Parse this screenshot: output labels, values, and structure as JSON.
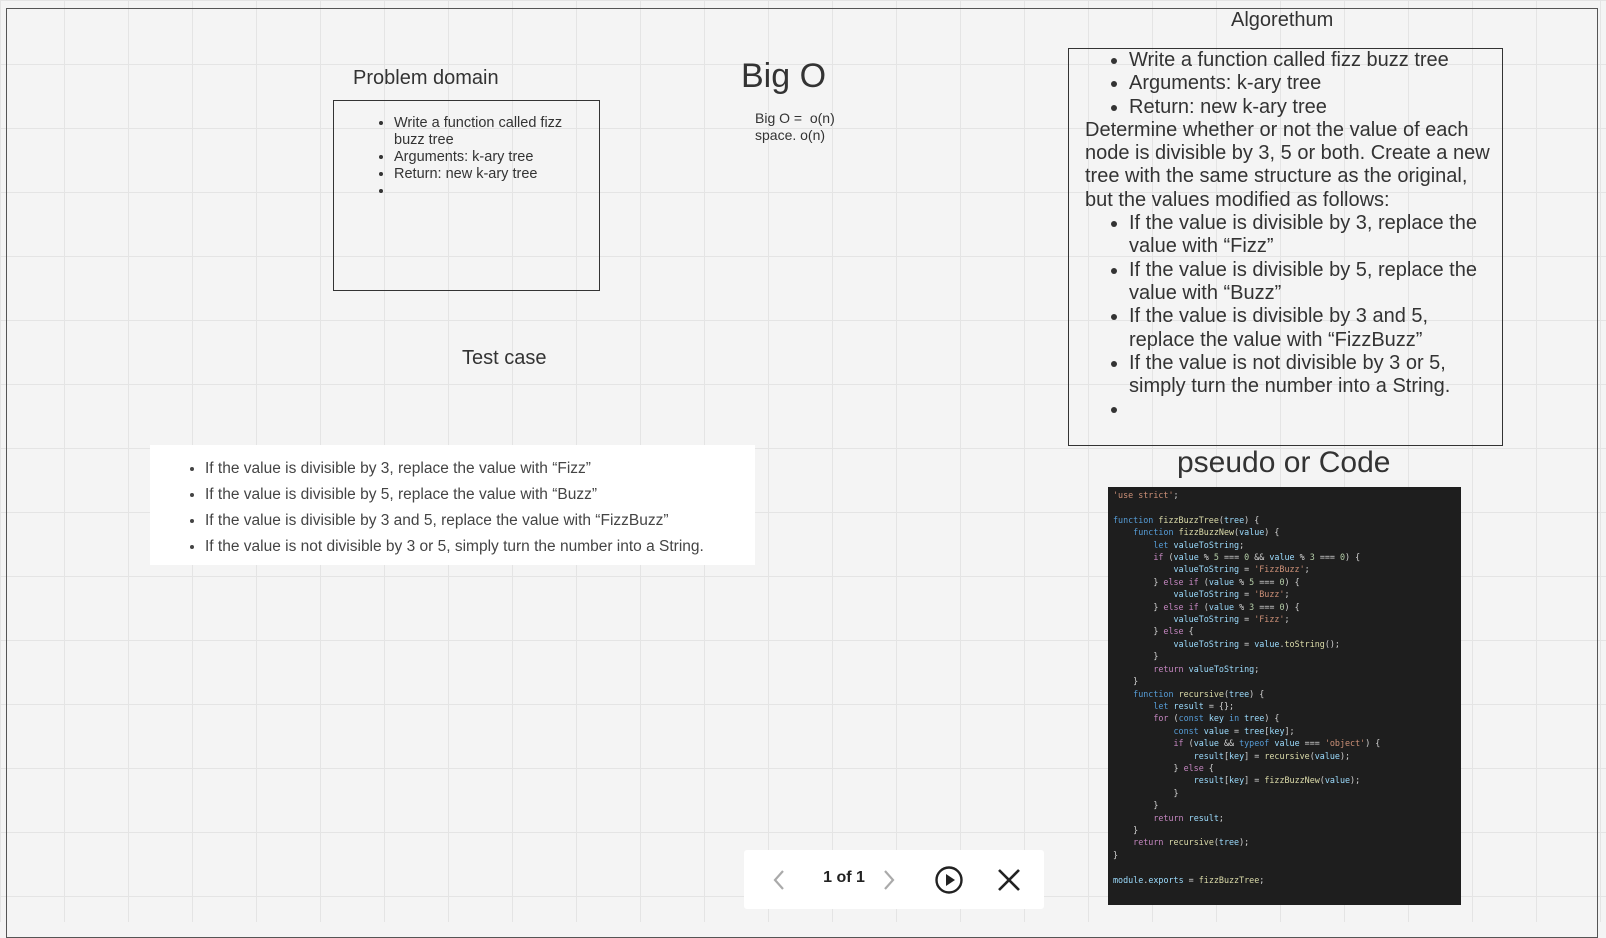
{
  "problem_domain": {
    "title": "Problem domain",
    "items": [
      "Write a function called fizz buzz tree",
      "Arguments: k-ary tree",
      "Return: new k-ary tree",
      ""
    ]
  },
  "big_o": {
    "title": "Big O",
    "text": "Big O =  o(n)\nspace. o(n)"
  },
  "test_case": {
    "title": "Test case",
    "items": [
      "If the value is divisible by 3, replace the value with “Fizz”",
      "If the value is divisible by 5, replace the value with “Buzz”",
      "If the value is divisible by 3 and 5, replace the value with “FizzBuzz”",
      "If the value is not divisible by 3 or 5, simply turn the number into a String."
    ]
  },
  "algorithm": {
    "title": "Algorethum",
    "items": [
      "Write a function called fizz buzz tree",
      "Arguments: k-ary tree",
      "Return: new k-ary tree"
    ],
    "paragraph": "Determine whether or not the value of each node is divisible by 3, 5 or both. Create a new tree with the same structure as the original, but the values modified as follows:",
    "rules": [
      "If the value is divisible by 3, replace the value with “Fizz”",
      "If the value is divisible by 5, replace the value with “Buzz”",
      "If the value is divisible by 3 and 5, replace the value with “FizzBuzz”",
      "If the value is not divisible by 3 or 5, simply turn the number into a String.",
      ""
    ]
  },
  "pseudo": {
    "title": "pseudo or Code"
  },
  "pager": {
    "count": "1 of 1"
  },
  "icons": {
    "prev": "chevron-left-icon",
    "next": "chevron-right-icon",
    "play": "play-circle-icon",
    "close": "close-icon"
  }
}
